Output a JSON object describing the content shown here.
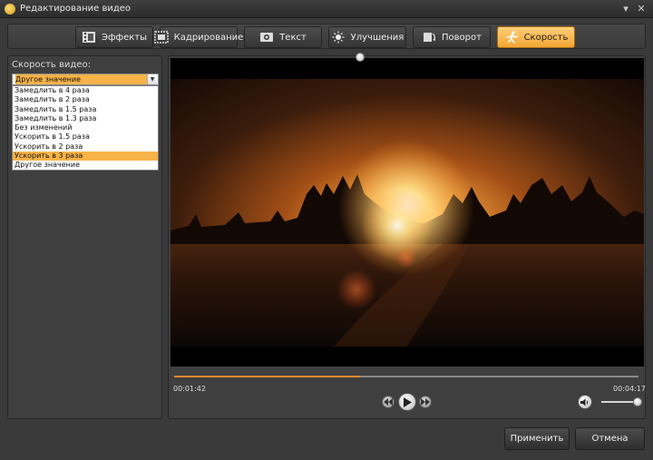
{
  "window": {
    "title": "Редактирование видео",
    "minimize": "▾",
    "close": "✕"
  },
  "tabs": [
    {
      "label": "Эффекты",
      "icon": "film-effects-icon"
    },
    {
      "label": "Кадрирование",
      "icon": "crop-frame-icon"
    },
    {
      "label": "Текст",
      "icon": "text-camera-icon"
    },
    {
      "label": "Улучшения",
      "icon": "sun-icon"
    },
    {
      "label": "Поворот",
      "icon": "rotate-icon"
    },
    {
      "label": "Скорость",
      "icon": "runner-icon",
      "active": true
    }
  ],
  "speed": {
    "label": "Скорость видео:",
    "selected": "Другое значение",
    "options": [
      "Замедлить в 4 раза",
      "Замедлить в 2 раза",
      "Замедлить в 1.5 раза",
      "Замедлить в 1.3 раза",
      "Без изменений",
      "Ускорить в 1.5 раза",
      "Ускорить в 2 раза",
      "Ускорить в 3 раза",
      "Другое значение"
    ],
    "highlighted_index": 7
  },
  "player": {
    "current_time": "00:01:42",
    "total_time": "00:04:17",
    "progress_fraction": 0.4,
    "volume_fraction": 1.0
  },
  "buttons": {
    "apply": "Применить",
    "cancel": "Отмена"
  },
  "colors": {
    "accent": "#f7b348",
    "progress": "#f08c2c"
  }
}
